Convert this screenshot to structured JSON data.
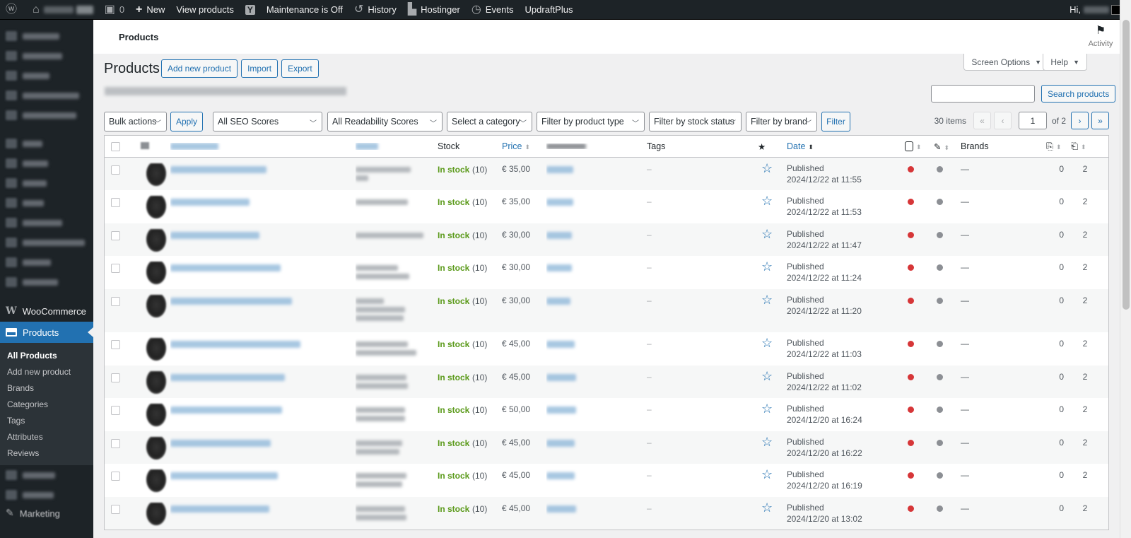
{
  "adminbar": {
    "comments_count": "0",
    "new_label": "New",
    "view_products_label": "View products",
    "yoast_label": "Y",
    "maintenance_label": "Maintenance is Off",
    "history_label": "History",
    "hostinger_label": "Hostinger",
    "events_label": "Events",
    "updraft_label": "UpdraftPlus",
    "greeting": "Hi,"
  },
  "menu": {
    "woocommerce_label": "WooCommerce",
    "products_label": "Products",
    "submenu": [
      "All Products",
      "Add new product",
      "Brands",
      "Categories",
      "Tags",
      "Attributes",
      "Reviews"
    ],
    "after_label": "Marketing"
  },
  "header": {
    "title": "Products",
    "activity_label": "Activity"
  },
  "screen_options": {
    "screen_options_label": "Screen Options",
    "help_label": "Help"
  },
  "page": {
    "title": "Products",
    "add_new_label": "Add new product",
    "import_label": "Import",
    "export_label": "Export",
    "search_button_label": "Search products"
  },
  "filters": {
    "bulk_actions": "Bulk actions",
    "apply": "Apply",
    "seo_scores": "All SEO Scores",
    "readability": "All Readability Scores",
    "category": "Select a category",
    "product_type": "Filter by product type",
    "stock_status": "Filter by stock status",
    "brand": "Filter by brand",
    "filter_button": "Filter"
  },
  "pagination": {
    "items": "30 items",
    "first": "«",
    "prev": "‹",
    "current_page": "1",
    "of_label": "of 2",
    "next": "›",
    "last": "»"
  },
  "table": {
    "columns": {
      "stock": "Stock",
      "price": "Price",
      "tags": "Tags",
      "featured": "★",
      "date": "Date",
      "brands": "Brands"
    },
    "rows": [
      {
        "stock": "In stock",
        "qty": "(10)",
        "price": "€ 35,00",
        "tags": "–",
        "status": "Published",
        "date": "2024/12/22 at 11:55",
        "brands": "—",
        "c1": "0",
        "c2": "2"
      },
      {
        "stock": "In stock",
        "qty": "(10)",
        "price": "€ 35,00",
        "tags": "–",
        "status": "Published",
        "date": "2024/12/22 at 11:53",
        "brands": "—",
        "c1": "0",
        "c2": "2"
      },
      {
        "stock": "In stock",
        "qty": "(10)",
        "price": "€ 30,00",
        "tags": "–",
        "status": "Published",
        "date": "2024/12/22 at 11:47",
        "brands": "—",
        "c1": "0",
        "c2": "2"
      },
      {
        "stock": "In stock",
        "qty": "(10)",
        "price": "€ 30,00",
        "tags": "–",
        "status": "Published",
        "date": "2024/12/22 at 11:24",
        "brands": "—",
        "c1": "0",
        "c2": "2"
      },
      {
        "stock": "In stock",
        "qty": "(10)",
        "price": "€ 30,00",
        "tags": "–",
        "status": "Published",
        "date": "2024/12/22 at 11:20",
        "brands": "—",
        "c1": "0",
        "c2": "2"
      },
      {
        "stock": "In stock",
        "qty": "(10)",
        "price": "€ 45,00",
        "tags": "–",
        "status": "Published",
        "date": "2024/12/22 at 11:03",
        "brands": "—",
        "c1": "0",
        "c2": "2"
      },
      {
        "stock": "In stock",
        "qty": "(10)",
        "price": "€ 45,00",
        "tags": "–",
        "status": "Published",
        "date": "2024/12/22 at 11:02",
        "brands": "—",
        "c1": "0",
        "c2": "2"
      },
      {
        "stock": "In stock",
        "qty": "(10)",
        "price": "€ 50,00",
        "tags": "–",
        "status": "Published",
        "date": "2024/12/20 at 16:24",
        "brands": "—",
        "c1": "0",
        "c2": "2"
      },
      {
        "stock": "In stock",
        "qty": "(10)",
        "price": "€ 45,00",
        "tags": "–",
        "status": "Published",
        "date": "2024/12/20 at 16:22",
        "brands": "—",
        "c1": "0",
        "c2": "2"
      },
      {
        "stock": "In stock",
        "qty": "(10)",
        "price": "€ 45,00",
        "tags": "–",
        "status": "Published",
        "date": "2024/12/20 at 16:19",
        "brands": "—",
        "c1": "0",
        "c2": "2"
      },
      {
        "stock": "In stock",
        "qty": "(10)",
        "price": "€ 45,00",
        "tags": "–",
        "status": "Published",
        "date": "2024/12/20 at 13:02",
        "brands": "—",
        "c1": "0",
        "c2": "2"
      }
    ]
  },
  "colors": {
    "seo_dot": "#d63638",
    "readability_dot": "#8c8f94",
    "accent": "#2271b1",
    "in_stock": "#5b9a1b"
  }
}
